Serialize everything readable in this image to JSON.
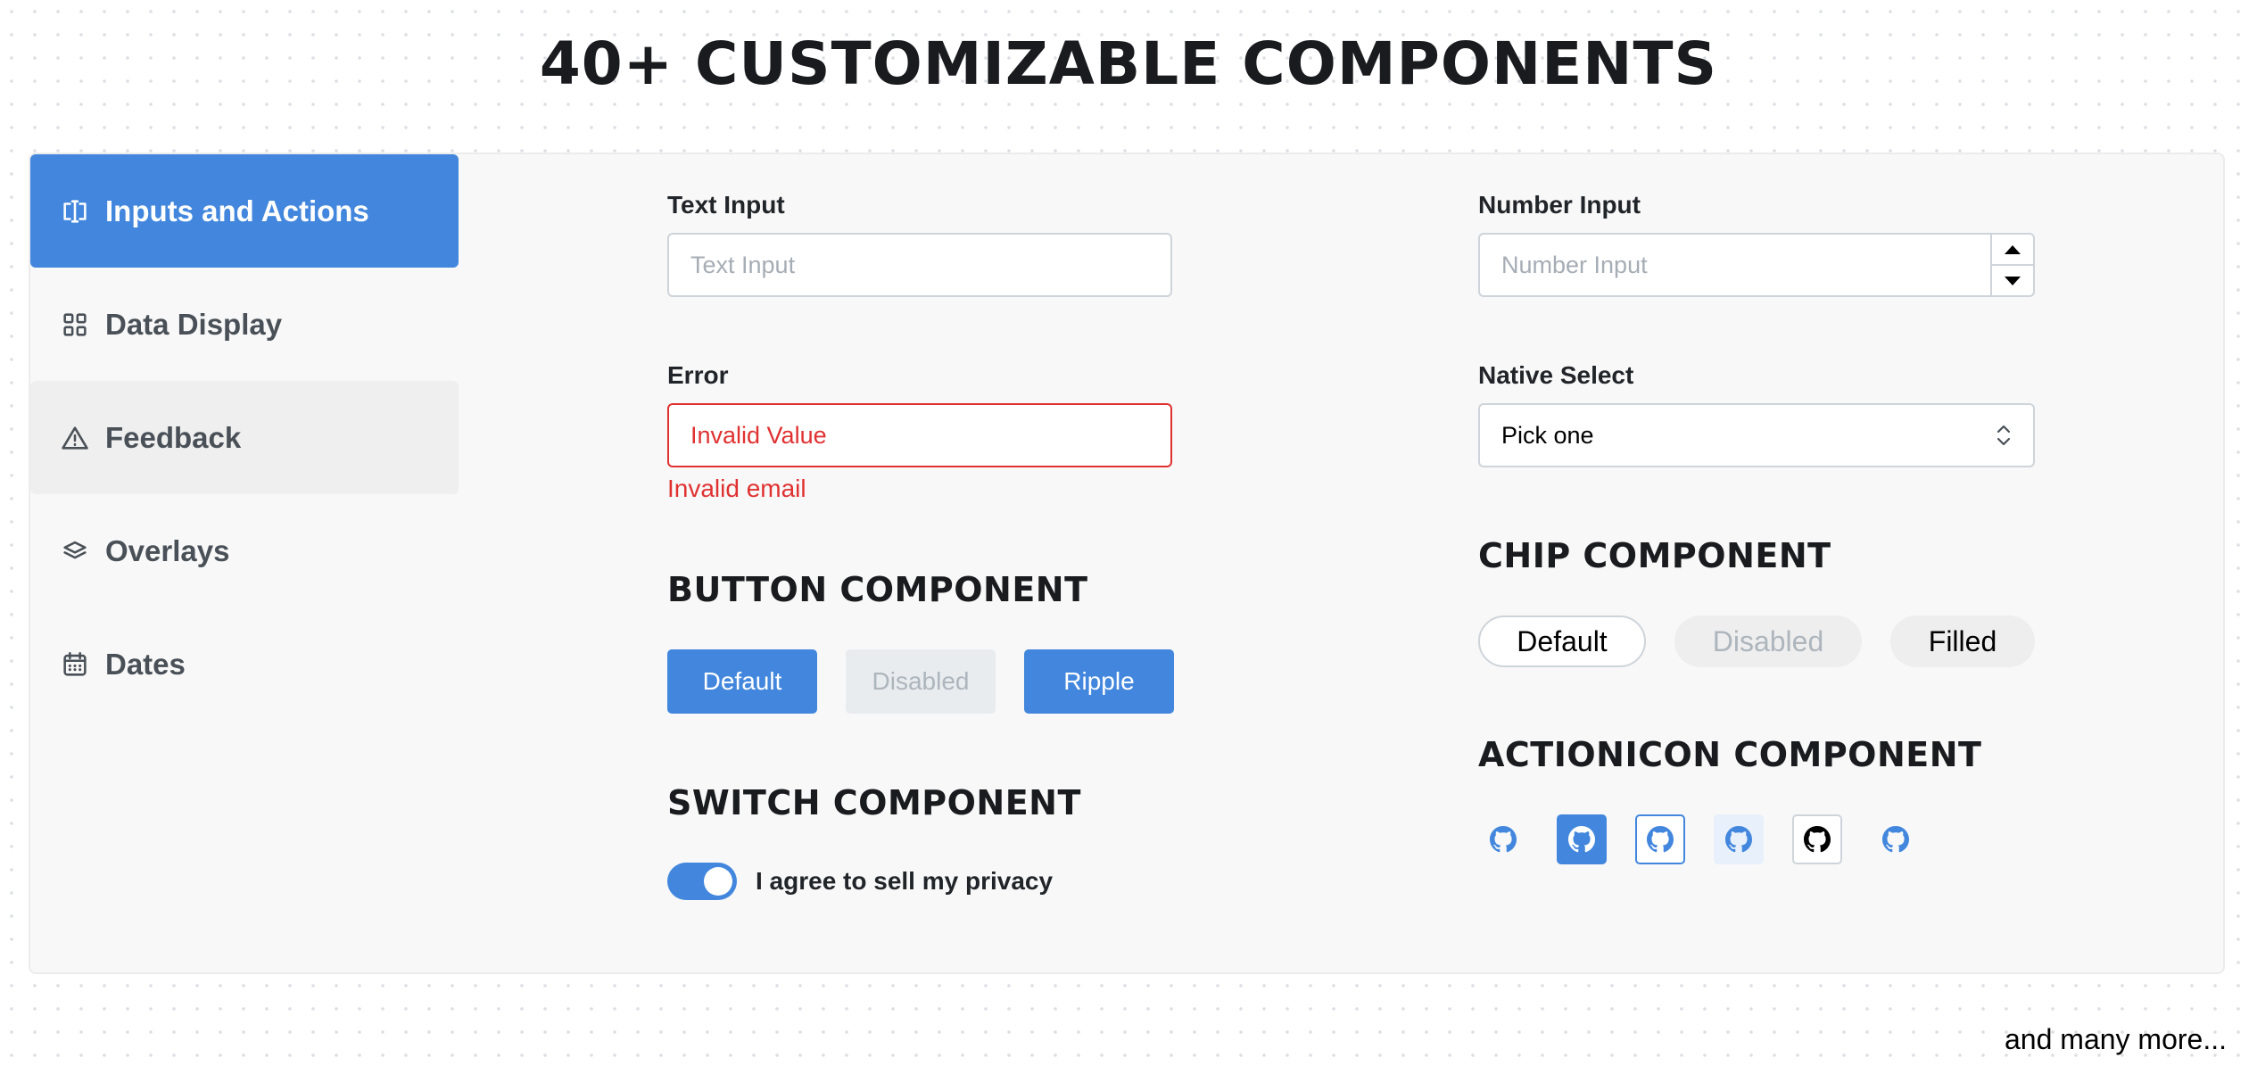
{
  "title": "40+ Customizable Components",
  "sidebar": {
    "items": [
      {
        "label": "Inputs and Actions",
        "icon": "input-cursor-icon",
        "state": "active"
      },
      {
        "label": "Data Display",
        "icon": "grid-icon",
        "state": "normal"
      },
      {
        "label": "Feedback",
        "icon": "alert-triangle-icon",
        "state": "hover"
      },
      {
        "label": "Overlays",
        "icon": "layers-icon",
        "state": "normal"
      },
      {
        "label": "Dates",
        "icon": "calendar-icon",
        "state": "normal"
      }
    ]
  },
  "text_input": {
    "label": "Text Input",
    "placeholder": "Text Input",
    "value": ""
  },
  "number_input": {
    "label": "Number Input",
    "placeholder": "Number Input",
    "value": ""
  },
  "error_input": {
    "label": "Error",
    "value": "Invalid Value",
    "error": "Invalid email"
  },
  "native_select": {
    "label": "Native Select",
    "value": "Pick one"
  },
  "button_component": {
    "heading": "Button Component",
    "buttons": [
      {
        "label": "Default",
        "variant": "primary"
      },
      {
        "label": "Disabled",
        "variant": "disabled"
      },
      {
        "label": "Ripple",
        "variant": "primary"
      }
    ]
  },
  "chip_component": {
    "heading": "Chip Component",
    "chips": [
      {
        "label": "Default",
        "variant": "outline"
      },
      {
        "label": "Disabled",
        "variant": "disabled"
      },
      {
        "label": "Filled",
        "variant": "filled"
      }
    ]
  },
  "switch_component": {
    "heading": "Switch Component",
    "label": "I agree to sell my privacy",
    "checked": true
  },
  "actionicon_component": {
    "heading": "ActionIcon Component",
    "icons": [
      {
        "icon": "github-icon",
        "variant": "subtle"
      },
      {
        "icon": "github-icon",
        "variant": "filled"
      },
      {
        "icon": "github-icon",
        "variant": "outline"
      },
      {
        "icon": "github-icon",
        "variant": "light"
      },
      {
        "icon": "github-icon",
        "variant": "default"
      },
      {
        "icon": "github-icon",
        "variant": "transparent"
      }
    ]
  },
  "footer": {
    "more": "and many more..."
  },
  "colors": {
    "accent": "#4287dd",
    "error": "#e03131",
    "panel_bg": "#f8f8f8"
  }
}
